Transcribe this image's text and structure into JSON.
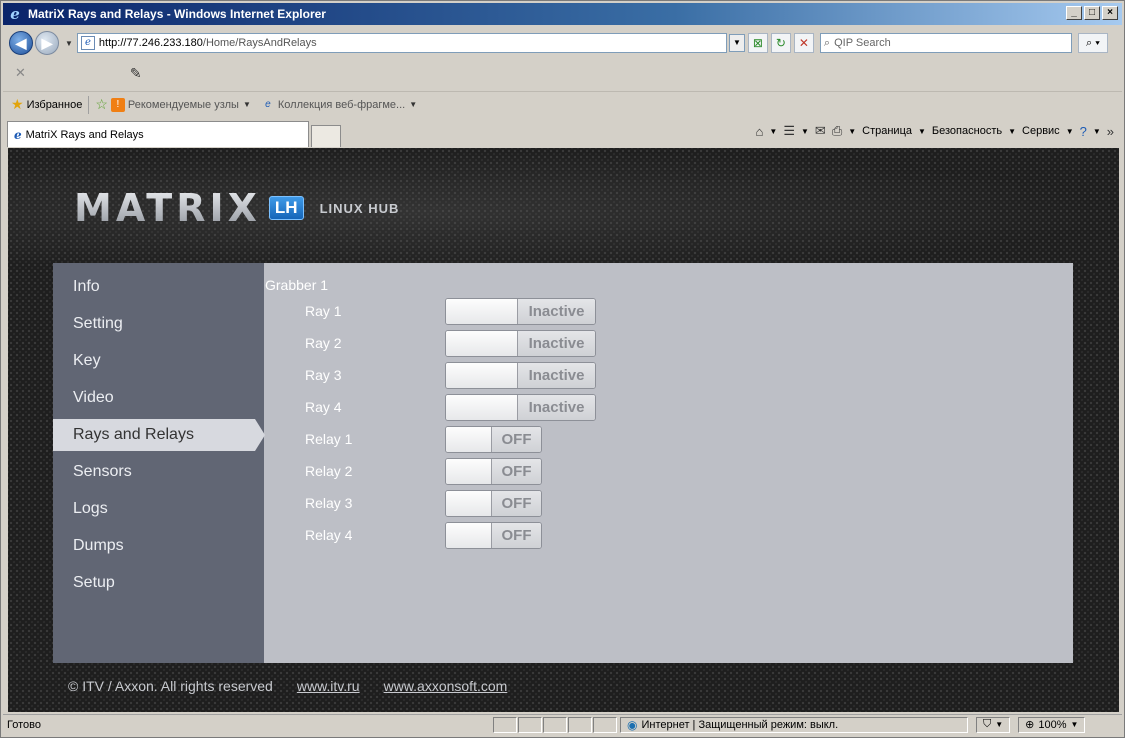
{
  "window": {
    "title": "MatriX Rays and Relays - Windows Internet Explorer"
  },
  "address": {
    "url_host": "http://77.246.233.180",
    "url_path": "/Home/RaysAndRelays",
    "search_placeholder": "QIP Search"
  },
  "favorites": {
    "label": "Избранное",
    "items": [
      "Рекомендуемые узлы",
      "Коллекция веб-фрагме..."
    ]
  },
  "tab": {
    "title": "MatriX Rays and Relays"
  },
  "commandbar": {
    "page": "Страница",
    "safety": "Безопасность",
    "service": "Сервис"
  },
  "app": {
    "logo": "MATRIX",
    "logo_badge": "LH",
    "logo_sub": "LINUX HUB",
    "nav": [
      {
        "label": "Info"
      },
      {
        "label": "Setting"
      },
      {
        "label": "Key"
      },
      {
        "label": "Video"
      },
      {
        "label": "Rays and Relays"
      },
      {
        "label": "Sensors"
      },
      {
        "label": "Logs"
      },
      {
        "label": "Dumps"
      },
      {
        "label": "Setup"
      }
    ],
    "active_nav": "Rays and Relays",
    "grabber_title": "Grabber 1",
    "rows": [
      {
        "label": "Ray 1",
        "state": "Inactive"
      },
      {
        "label": "Ray 2",
        "state": "Inactive"
      },
      {
        "label": "Ray 3",
        "state": "Inactive"
      },
      {
        "label": "Ray 4",
        "state": "Inactive"
      },
      {
        "label": "Relay 1",
        "state": "OFF"
      },
      {
        "label": "Relay 2",
        "state": "OFF"
      },
      {
        "label": "Relay 3",
        "state": "OFF"
      },
      {
        "label": "Relay 4",
        "state": "OFF"
      }
    ],
    "footer": {
      "copyright": "© ITV / Axxon. All rights reserved",
      "link1": "www.itv.ru",
      "link2": "www.axxonsoft.com"
    }
  },
  "status": {
    "text": "Готово",
    "zone": "Интернет | Защищенный режим: выкл.",
    "zoom": "100%"
  }
}
